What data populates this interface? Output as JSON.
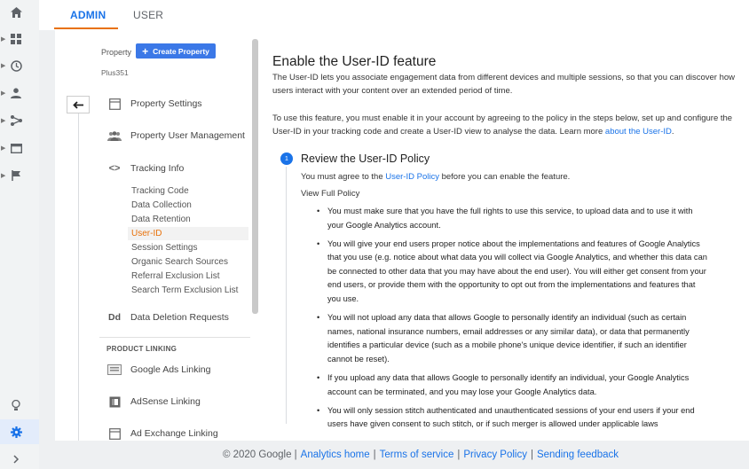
{
  "tabs": {
    "admin": "ADMIN",
    "user": "USER"
  },
  "property": {
    "label": "Property",
    "create_button": "Create Property",
    "name": "Plus351"
  },
  "nav": {
    "property_settings": "Property Settings",
    "property_user_management": "Property User Management",
    "tracking_info": "Tracking Info",
    "tracking_sub": [
      "Tracking Code",
      "Data Collection",
      "Data Retention",
      "User-ID",
      "Session Settings",
      "Organic Search Sources",
      "Referral Exclusion List",
      "Search Term Exclusion List"
    ],
    "data_deletion_icon": "Dd",
    "data_deletion": "Data Deletion Requests",
    "product_linking": "PRODUCT LINKING",
    "google_ads_linking": "Google Ads Linking",
    "adsense_linking": "AdSense Linking",
    "ad_exchange_linking": "Ad Exchange Linking"
  },
  "main": {
    "title": "Enable the User-ID feature",
    "intro": "The User-ID lets you associate engagement data from different devices and multiple sessions, so that you can discover how users interact with your content over an extended period of time.",
    "para2": "To use this feature, you must enable it in your account by agreeing to the policy in the steps below, set up and configure the User-ID in your tracking code and create a User-ID view to analyse the data. Learn more",
    "para2_link": "about the User-ID",
    "para2_end": ".",
    "step1_num": "1",
    "step1_title": "Review the User-ID Policy",
    "step1_text_pre": "You must agree to the",
    "step1_link": "User-ID Policy",
    "step1_text_post": "before you can enable the feature.",
    "view_full": "View Full Policy",
    "bullets": [
      "You must make sure that you have the full rights to use this service, to upload data and to use it with your Google Analytics account.",
      "You will give your end users proper notice about the implementations and features of Google Analytics that you use (e.g. notice about what data you will collect via Google Analytics, and whether this data can be connected to other data that you may have about the end user). You will either get consent from your end users, or provide them with the opportunity to opt out from the implementations and features that you use.",
      "You will not upload any data that allows Google to personally identify an individual (such as certain names, national insurance numbers, email addresses or any similar data), or data that permanently identifies a particular device (such as a mobile phone's unique device identifier, if such an identifier cannot be reset).",
      "If you upload any data that allows Google to personally identify an individual, your Google Analytics account can be terminated, and you may lose your Google Analytics data.",
      "You will only session stitch authenticated and unauthenticated sessions of your end users if your end users have given consent to such stitch, or if such merger is allowed under applicable laws"
    ]
  },
  "footer": {
    "copyright": "© 2020 Google |",
    "analytics_home": "Analytics home",
    "terms": "Terms of service",
    "privacy": "Privacy Policy",
    "feedback": "Sending feedback",
    "sep": "|"
  },
  "icons": {
    "rail": [
      "home-icon",
      "dashboard-icon",
      "clock-icon",
      "person-icon",
      "acquisition-icon",
      "behavior-icon",
      "flag-icon",
      "lightbulb-icon",
      "gear-icon",
      "expand-icon"
    ]
  }
}
